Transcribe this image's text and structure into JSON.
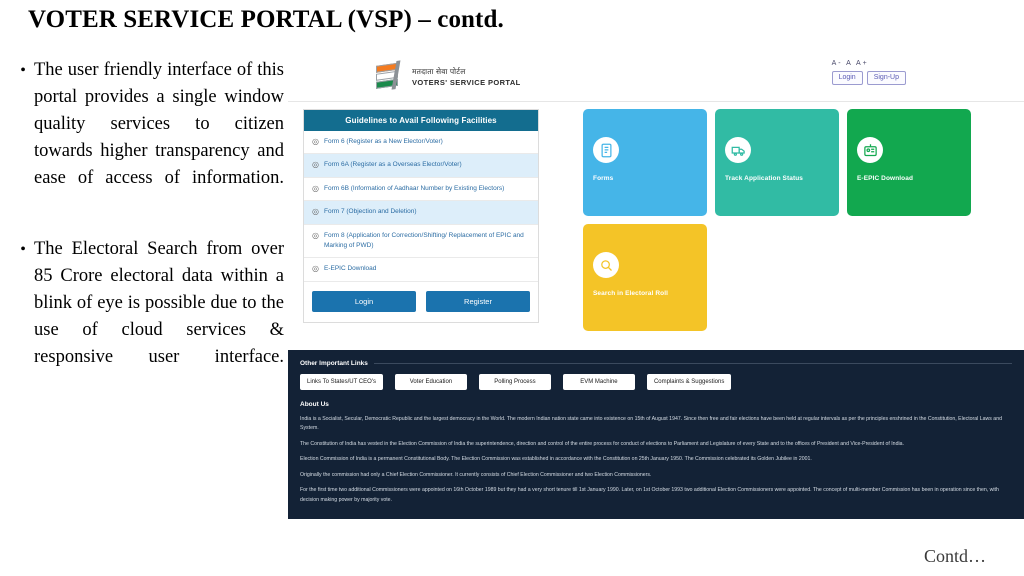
{
  "slide": {
    "title": "VOTER SERVICE PORTAL (VSP) – contd.",
    "continuation_note": "Contd…",
    "bullets": [
      "The user friendly interface of this portal provides a single window quality services to citizen towards higher transparency and ease of access of information.",
      "The Electoral Search from over 85 Crore electoral data within a blink of eye is possible due to the use of cloud services & responsive user interface."
    ]
  },
  "vsp": {
    "brand": {
      "hindi": "मतदाता सेवा पोर्टल",
      "english": "VOTERS' SERVICE PORTAL",
      "logo_icon": "eci-logo-icon"
    },
    "font_size_controls": "A- A A+",
    "auth": {
      "login": "Login",
      "signup": "Sign-Up"
    },
    "guidelines": {
      "header": "Guidelines to Avail Following Facilities",
      "item_icon": "circle-target-icon",
      "items": [
        "Form 6 (Register as a New Elector/Voter)",
        "Form 6A (Register as a Overseas Elector/Voter)",
        "Form 6B (Information of Aadhaar Number by Existing Electors)",
        "Form 7 (Objection and Deletion)",
        "Form 8 (Application for Correction/Shifting/ Replacement of EPIC and Marking of PWD)",
        "E-EPIC Download"
      ],
      "login_button": "Login",
      "register_button": "Register"
    },
    "tiles": [
      {
        "label": "Forms",
        "color": "#45b5e8",
        "icon": "forms-icon"
      },
      {
        "label": "Track Application Status",
        "color": "#31bba4",
        "icon": "truck-icon"
      },
      {
        "label": "E-EPIC Download",
        "color": "#12a84f",
        "icon": "id-card-icon"
      },
      {
        "label": "Search in Electoral Roll",
        "color": "#f4c427",
        "icon": "search-icon"
      }
    ],
    "footer": {
      "links_heading": "Other Important Links",
      "links": [
        "Links To States/UT CEO's",
        "Voter Education",
        "Polling Process",
        "EVM Machine",
        "Complaints & Suggestions"
      ],
      "about_heading": "About Us",
      "paragraphs": [
        "India is a Socialist, Secular, Democratic Republic and the largest democracy in the World. The modern Indian nation state came into existence on 15th of August 1947. Since then free and fair elections have been held at regular intervals as per the principles enshrined in the Constitution, Electoral Laws and System.",
        "The Constitution of India has vested in the Election Commission of India the superintendence, direction and control of the entire process for conduct of elections to Parliament and Legislature of every State and to the offices of President and Vice-President of India.",
        "Election Commission of India is a permanent Constitutional Body. The Election Commission was established in accordance with the Constitution on 25th January 1950. The Commission celebrated its Golden Jubilee in 2001.",
        "Originally the commission had only a Chief Election Commissioner. It currently consists of Chief Election Commissioner and two Election Commissioners.",
        "For the first time two additional Commissioners were appointed on 16th October 1989 but they had a very short tenure till 1st January 1990. Later, on 1st October 1993 two additional Election Commissioners were appointed. The concept of multi-member Commission has been in operation since then, with decision making power by majority vote."
      ]
    }
  }
}
